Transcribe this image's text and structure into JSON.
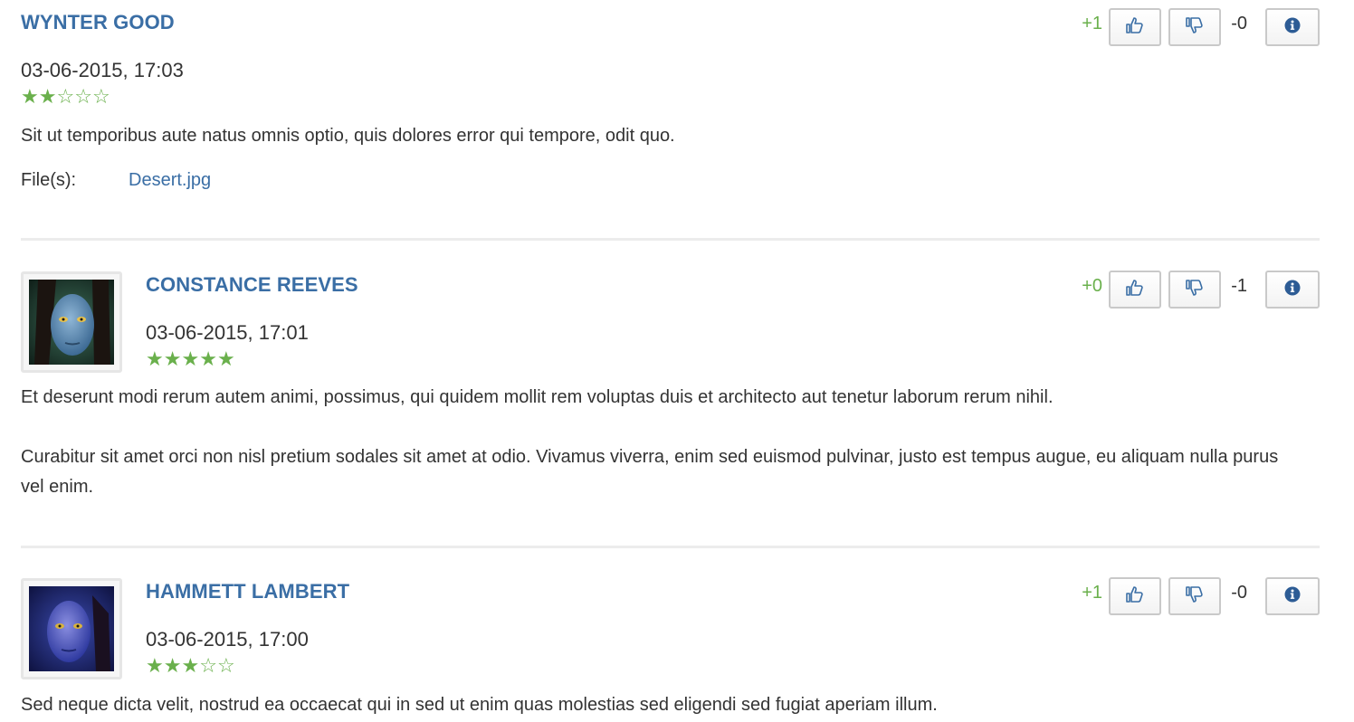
{
  "reviews": [
    {
      "author": "Wynter Good",
      "date": "03-06-2015, 17:03",
      "rating": 2,
      "max_rating": 5,
      "paragraphs": [
        "Sit ut temporibus aute natus omnis optio, quis dolores error qui tempore, odit quo."
      ],
      "files_label": "File(s):",
      "file_name": "Desert.jpg",
      "likes": "+1",
      "dislikes": "-0"
    },
    {
      "author": "Constance Reeves",
      "date": "03-06-2015, 17:01",
      "rating": 5,
      "max_rating": 5,
      "paragraphs": [
        "Et deserunt modi rerum autem animi, possimus, qui quidem mollit rem voluptas duis et architecto aut tenetur laborum rerum nihil.",
        "Curabitur sit amet orci non nisl pretium sodales sit amet at odio. Vivamus viverra, enim sed euismod pulvinar, justo est tempus augue, eu aliquam nulla purus vel enim."
      ],
      "likes": "+0",
      "dislikes": "-1"
    },
    {
      "author": "Hammett Lambert",
      "date": "03-06-2015, 17:00",
      "rating": 3,
      "max_rating": 5,
      "paragraphs": [
        "Sed neque dicta velit, nostrud ea occaecat qui in sed ut enim quas molestias sed eligendi sed fugiat aperiam illum."
      ],
      "likes": "+1",
      "dislikes": "-0"
    }
  ],
  "icons": {
    "like": "thumbs-up-icon",
    "dislike": "thumbs-down-icon",
    "info": "info-circle-icon"
  },
  "colors": {
    "author": "#3a6ea5",
    "link": "#3a6ea5",
    "star": "#6ab04c",
    "like_count": "#6ab04c",
    "text": "#333333",
    "button_border": "#c9c9c9",
    "divider": "#ececec"
  }
}
